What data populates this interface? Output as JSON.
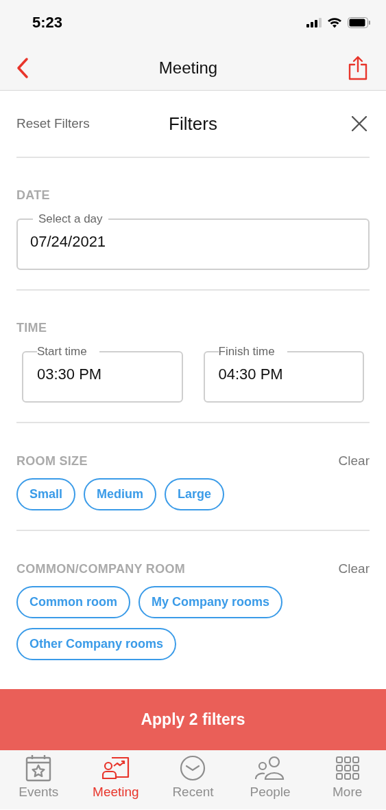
{
  "status_bar": {
    "time": "5:23"
  },
  "nav": {
    "title": "Meeting"
  },
  "filters": {
    "reset": "Reset Filters",
    "title": "Filters"
  },
  "sections": [
    {
      "kind": "date",
      "heading": "DATE",
      "fields": [
        {
          "label": "Select a day",
          "value": "07/24/2021"
        }
      ]
    },
    {
      "kind": "time",
      "heading": "TIME",
      "fields": [
        {
          "label": "Start time",
          "value": "03:30 PM"
        },
        {
          "label": "Finish time",
          "value": "04:30 PM"
        }
      ]
    },
    {
      "kind": "chips",
      "heading": "ROOM SIZE",
      "clear": "Clear",
      "chips": [
        {
          "label": "Small",
          "selected": false
        },
        {
          "label": "Medium",
          "selected": false
        },
        {
          "label": "Large",
          "selected": false
        }
      ]
    },
    {
      "kind": "chips",
      "heading": "COMMON/COMPANY ROOM",
      "clear": "Clear",
      "chips": [
        {
          "label": "Common room",
          "selected": false
        },
        {
          "label": "My Company rooms",
          "selected": false
        },
        {
          "label": "Other Company rooms",
          "selected": false
        }
      ]
    }
  ],
  "apply_button": "Apply 2 filters",
  "tabs": [
    {
      "label": "Events",
      "selected": false
    },
    {
      "label": "Meeting",
      "selected": true
    },
    {
      "label": "Recent",
      "selected": false
    },
    {
      "label": "People",
      "selected": false
    },
    {
      "label": "More",
      "selected": false
    }
  ]
}
